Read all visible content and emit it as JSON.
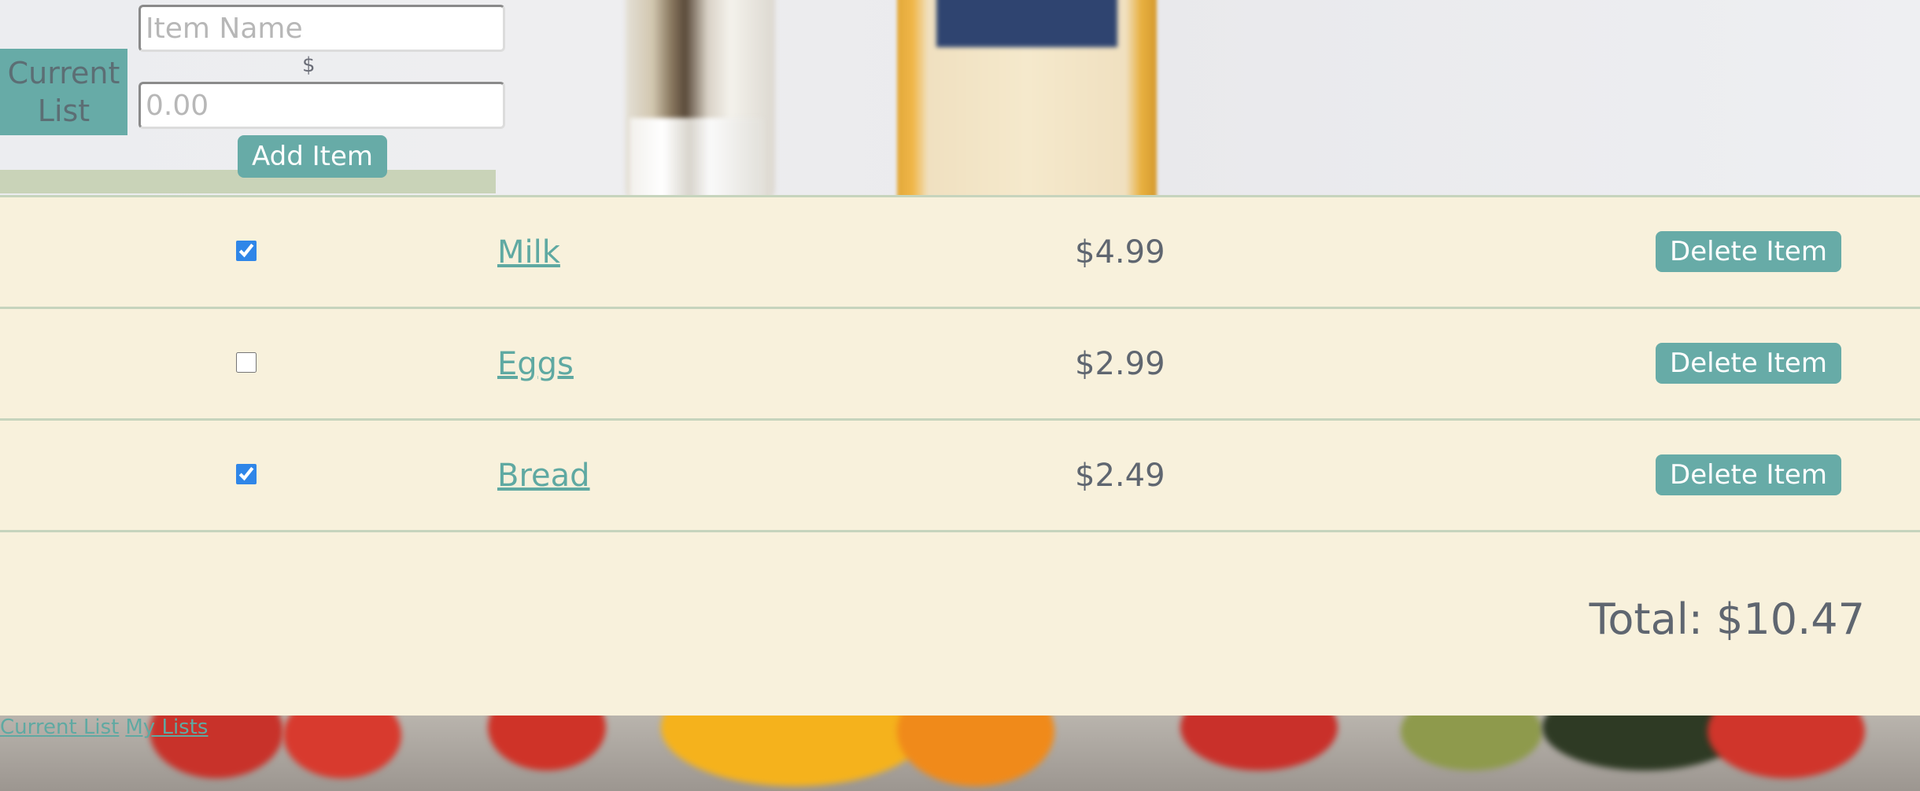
{
  "header": {
    "current_list_label": "Current List",
    "current_list_line1": "Current",
    "current_list_line2": "List"
  },
  "form": {
    "name_placeholder": "Item Name",
    "currency_symbol": "$",
    "price_placeholder": "0.00",
    "add_button_label": "Add Item"
  },
  "items": [
    {
      "name": "Milk",
      "price": "$4.99",
      "checked": true,
      "delete_label": "Delete Item"
    },
    {
      "name": "Eggs",
      "price": "$2.99",
      "checked": false,
      "delete_label": "Delete Item"
    },
    {
      "name": "Bread",
      "price": "$2.49",
      "checked": true,
      "delete_label": "Delete Item"
    }
  ],
  "total": "Total: $10.47",
  "footer": {
    "links": [
      "Current List",
      "My Lists"
    ]
  },
  "colors": {
    "accent": "#67aba7",
    "panel_background": "#f8f1dc",
    "row_divider": "#c6d4bd",
    "checkbox": "#2f86e8",
    "text": "#5f6670"
  }
}
